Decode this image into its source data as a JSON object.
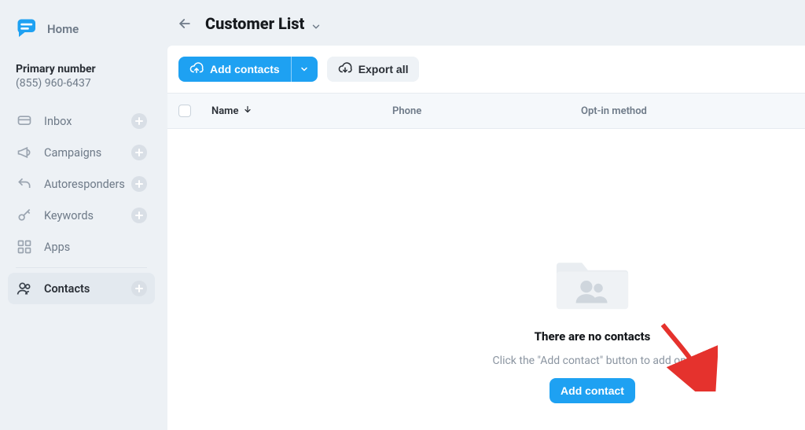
{
  "brand": {
    "home_label": "Home"
  },
  "primary": {
    "label": "Primary number",
    "value": "(855) 960-6437"
  },
  "sidebar": {
    "items": [
      {
        "label": "Inbox"
      },
      {
        "label": "Campaigns"
      },
      {
        "label": "Autoresponders"
      },
      {
        "label": "Keywords"
      },
      {
        "label": "Apps"
      },
      {
        "label": "Contacts"
      }
    ]
  },
  "header": {
    "title": "Customer List"
  },
  "toolbar": {
    "add_contacts_label": "Add contacts",
    "export_all_label": "Export all"
  },
  "table": {
    "columns": {
      "name": "Name",
      "phone": "Phone",
      "optin": "Opt-in method"
    }
  },
  "empty": {
    "title": "There are no contacts",
    "subtitle": "Click the \"Add contact\" button to add one",
    "button_label": "Add contact"
  },
  "colors": {
    "accent": "#1ea1f2",
    "muted": "#6e7a88"
  }
}
